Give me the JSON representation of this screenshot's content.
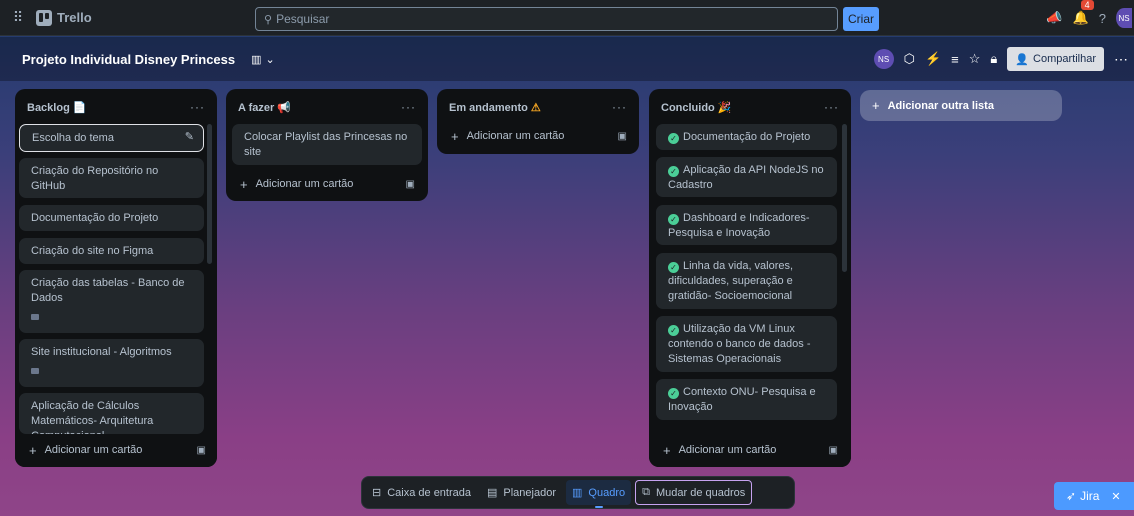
{
  "topbar": {
    "app_name": "Trello",
    "search_placeholder": "Pesquisar",
    "create_label": "Criar",
    "notification_count": "4",
    "avatar_initials": "NS"
  },
  "board": {
    "title": "Projeto Individual Disney Princess",
    "avatar_initials": "NS",
    "share_label": "Compartilhar"
  },
  "lists": [
    {
      "title": "Backlog",
      "title_emoji": "📄",
      "cards": [
        "Escolha do tema",
        "Criação do Repositório no GitHub",
        "Documentação do Projeto",
        "Criação do site no Figma",
        "Criação das tabelas - Banco de Dados",
        "Site institucional - Algoritmos",
        "Aplicação de Cálculos Matemáticos- Arquitetura Computacional"
      ],
      "add_card_label": "Adicionar um cartão"
    },
    {
      "title": "A fazer",
      "title_emoji": "📢",
      "cards": [
        "Colocar Playlist das Princesas no site"
      ],
      "add_card_label": "Adicionar um cartão"
    },
    {
      "title": "Em andamento",
      "title_emoji": "⚠",
      "cards": [],
      "add_card_label": "Adicionar um cartão"
    },
    {
      "title": "Concluido",
      "title_emoji": "🎉",
      "cards": [
        "Documentação do Projeto",
        "Aplicação da API NodeJS no Cadastro",
        "Dashboard e Indicadores- Pesquisa e Inovação",
        "Linha da vida, valores, dificuldades, superação e gratidão- Socioemocional",
        "Utilização da VM Linux contendo o banco de dados - Sistemas Operacionais",
        "Contexto ONU- Pesquisa e Inovação"
      ],
      "add_card_label": "Adicionar um cartão"
    }
  ],
  "add_list_label": "Adicionar outra lista",
  "bottom_nav": {
    "inbox": "Caixa de entrada",
    "planner": "Planejador",
    "board": "Quadro",
    "switch": "Mudar de quadros"
  },
  "jira_label": "Jira",
  "colors": {
    "accent": "#579dff",
    "check": "#4bce97",
    "list_bg": "#101204"
  }
}
